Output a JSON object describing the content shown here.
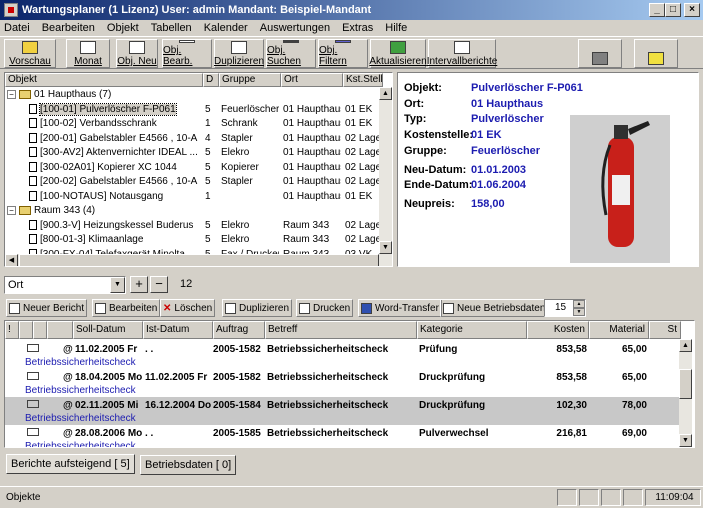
{
  "window": {
    "title": "Wartungsplaner  (1 Lizenz)   User: admin Mandant: Beispiel-Mandant",
    "btn_min": "_",
    "btn_max": "□",
    "btn_close": "×"
  },
  "menu": [
    "Datei",
    "Bearbeiten",
    "Objekt",
    "Tabellen",
    "Kalender",
    "Auswertungen",
    "Extras",
    "Hilfe"
  ],
  "toolbar": {
    "buttons": [
      "Vorschau",
      "Monat",
      "Obj. Neu",
      "Obj. Bearb.",
      "Duplizieren",
      "Obj. Suchen",
      "Obj. Filtern",
      "Aktualisieren",
      "Intervallberichte"
    ]
  },
  "tree": {
    "headers": [
      "Objekt",
      "D",
      "Gruppe",
      "Ort",
      "Kst.Stell"
    ],
    "groups": [
      {
        "label": "01 Haupthaus  (7)",
        "items": [
          {
            "name": "[100-01] Pulverlöscher F-P061",
            "d": "5",
            "gruppe": "Feuerlöscher",
            "ort": "01 Haupthaus",
            "kst": "01 EK"
          },
          {
            "name": "[100-02] Verbandsschrank",
            "d": "1",
            "gruppe": "Schrank",
            "ort": "01 Haupthaus",
            "kst": "01 EK"
          },
          {
            "name": "[200-01] Gabelstabler E4566 , 10-A",
            "d": "4",
            "gruppe": "Stapler",
            "ort": "01 Haupthaus",
            "kst": "02 Lage"
          },
          {
            "name": "[300-AV2] Aktenvernichter IDEAL ...",
            "d": "5",
            "gruppe": "Elekro",
            "ort": "01 Haupthaus",
            "kst": "02 Lage"
          },
          {
            "name": "[300-02A01] Kopierer  XC 1044",
            "d": "5",
            "gruppe": "Kopierer",
            "ort": "01 Haupthaus",
            "kst": "02 Lage"
          },
          {
            "name": "[200-02] Gabelstabler E4566 , 10-A",
            "d": "5",
            "gruppe": "Stapler",
            "ort": "01 Haupthaus",
            "kst": "02 Lage"
          },
          {
            "name": "[100-NOTAUS] Notausgang",
            "d": "1",
            "gruppe": "",
            "ort": "01 Haupthaus",
            "kst": "01 EK"
          }
        ]
      },
      {
        "label": "Raum 343  (4)",
        "items": [
          {
            "name": "[900.3-V] Heizungskessel Buderus",
            "d": "5",
            "gruppe": "Elekro",
            "ort": "Raum 343",
            "kst": "02 Lage"
          },
          {
            "name": "[800-01-3] Klimaanlage",
            "d": "5",
            "gruppe": "Elekro",
            "ort": "Raum 343",
            "kst": "02 Lage"
          },
          {
            "name": "[300-FX-04] Telefaxgerät Minolta",
            "d": "5",
            "gruppe": "Fax / Drucker",
            "ort": "Raum 343",
            "kst": "03 VK"
          }
        ]
      }
    ]
  },
  "detail": {
    "rows": [
      {
        "label": "Objekt:",
        "value": "Pulverlöscher F-P061"
      },
      {
        "label": "Ort:",
        "value": "01 Haupthaus"
      },
      {
        "label": "Typ:",
        "value": "Pulverlöscher"
      },
      {
        "label": "Kostenstelle:",
        "value": "01 EK"
      },
      {
        "label": "Gruppe:",
        "value": "Feuerlöscher"
      },
      {
        "label": "Neu-Datum:",
        "value": "01.01.2003"
      },
      {
        "label": "Ende-Datum:",
        "value": "01.06.2004"
      },
      {
        "label": "Neupreis:",
        "value": "158,00"
      }
    ]
  },
  "filter": {
    "combo_value": "Ort",
    "plus": "+",
    "minus": "−",
    "count": "12"
  },
  "toolbar2": {
    "buttons": [
      "Neuer Bericht",
      "Bearbeiten",
      "Löschen",
      "Duplizieren",
      "Drucken",
      "Word-Transfer",
      "Neue Betriebsdaten"
    ],
    "spin_value": "15"
  },
  "grid": {
    "headers": [
      "!",
      "",
      "",
      "",
      "Soll-Datum",
      "Ist-Datum",
      "Auftrag",
      "Betreff",
      "Kategorie",
      "Kosten",
      "Material",
      "St"
    ],
    "rows": [
      {
        "soll": "11.02.2005 Fr",
        "ist": ".  .",
        "auftrag": "2005-1582",
        "betreff": "Betriebssicherheitscheck",
        "kategorie": "Prüfung",
        "kosten": "853,58",
        "material": "65,00",
        "sub": "Betriebssicherheitscheck",
        "shaded": false
      },
      {
        "soll": "18.04.2005 Mo",
        "ist": "11.02.2005 Fr",
        "auftrag": "2005-1582",
        "betreff": "Betriebssicherheitscheck",
        "kategorie": "Druckprüfung",
        "kosten": "853,58",
        "material": "65,00",
        "sub": "Betriebssicherheitscheck",
        "shaded": false
      },
      {
        "soll": "02.11.2005 Mi",
        "ist": "16.12.2004 Do",
        "auftrag": "2005-1584",
        "betreff": "Betriebssicherheitscheck",
        "kategorie": "Druckprüfung",
        "kosten": "102,30",
        "material": "78,00",
        "sub": "Betriebssicherheitscheck",
        "shaded": true
      },
      {
        "soll": "28.08.2006 Mo",
        "ist": ".  .",
        "auftrag": "2005-1585",
        "betreff": "Betriebssicherheitscheck",
        "kategorie": "Pulverwechsel",
        "kosten": "216,81",
        "material": "69,00",
        "sub": "Betriebssicherheitscheck",
        "shaded": false
      }
    ]
  },
  "tabs": [
    "Berichte aufsteigend [  5]",
    "Betriebsdaten [  0]"
  ],
  "status": {
    "left": "Objekte",
    "time": "11:09:04"
  }
}
